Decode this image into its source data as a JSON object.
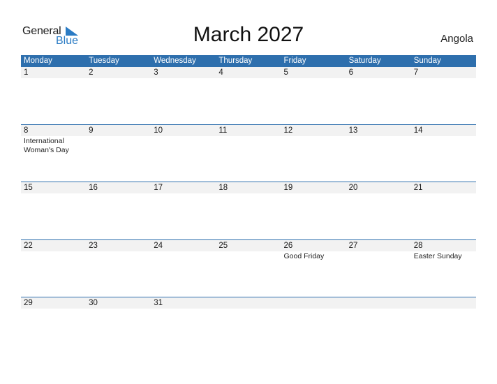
{
  "brand": {
    "general": "General",
    "blue": "Blue",
    "accent_color": "#2a7bc4"
  },
  "title": "March 2027",
  "country": "Angola",
  "header_color": "#2e6fad",
  "weekdays": [
    "Monday",
    "Tuesday",
    "Wednesday",
    "Thursday",
    "Friday",
    "Saturday",
    "Sunday"
  ],
  "weeks": [
    {
      "days": [
        "1",
        "2",
        "3",
        "4",
        "5",
        "6",
        "7"
      ],
      "events": [
        "",
        "",
        "",
        "",
        "",
        "",
        ""
      ]
    },
    {
      "days": [
        "8",
        "9",
        "10",
        "11",
        "12",
        "13",
        "14"
      ],
      "events": [
        "International Woman's Day",
        "",
        "",
        "",
        "",
        "",
        ""
      ]
    },
    {
      "days": [
        "15",
        "16",
        "17",
        "18",
        "19",
        "20",
        "21"
      ],
      "events": [
        "",
        "",
        "",
        "",
        "",
        "",
        ""
      ]
    },
    {
      "days": [
        "22",
        "23",
        "24",
        "25",
        "26",
        "27",
        "28"
      ],
      "events": [
        "",
        "",
        "",
        "",
        "Good Friday",
        "",
        "Easter Sunday"
      ]
    },
    {
      "days": [
        "29",
        "30",
        "31",
        "",
        "",
        "",
        ""
      ],
      "events": [
        "",
        "",
        "",
        "",
        "",
        "",
        ""
      ]
    }
  ]
}
